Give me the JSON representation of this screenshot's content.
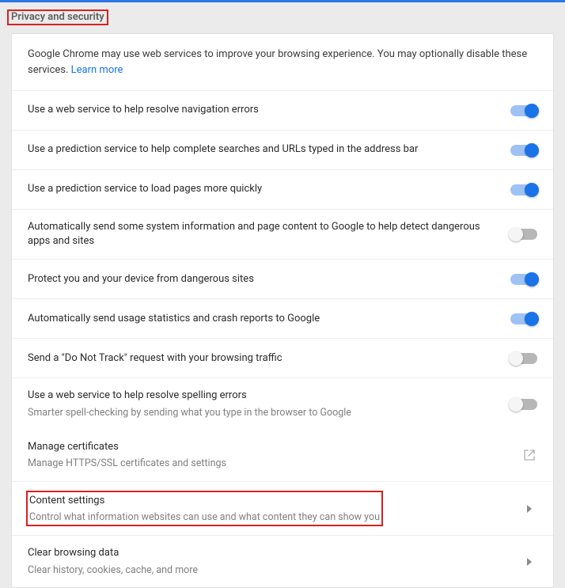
{
  "section_title": "Privacy and security",
  "intro": {
    "text": "Google Chrome may use web services to improve your browsing experience. You may optionally disable these services. ",
    "link": "Learn more"
  },
  "items": [
    {
      "title": "Use a web service to help resolve navigation errors",
      "toggle": true
    },
    {
      "title": "Use a prediction service to help complete searches and URLs typed in the address bar",
      "toggle": true
    },
    {
      "title": "Use a prediction service to load pages more quickly",
      "toggle": true
    },
    {
      "title": "Automatically send some system information and page content to Google to help detect dangerous apps and sites",
      "toggle": false
    },
    {
      "title": "Protect you and your device from dangerous sites",
      "toggle": true
    },
    {
      "title": "Automatically send usage statistics and crash reports to Google",
      "toggle": true
    },
    {
      "title": "Send a \"Do Not Track\" request with your browsing traffic",
      "toggle": false
    },
    {
      "title": "Use a web service to help resolve spelling errors",
      "sub": "Smarter spell-checking by sending what you type in the browser to Google",
      "toggle": false
    }
  ],
  "nav": [
    {
      "title": "Manage certificates",
      "sub": "Manage HTTPS/SSL certificates and settings",
      "icon": "external"
    },
    {
      "title": "Content settings",
      "sub": "Control what information websites can use and what content they can show you",
      "icon": "chevron",
      "highlight": true
    },
    {
      "title": "Clear browsing data",
      "sub": "Clear history, cookies, cache, and more",
      "icon": "chevron"
    }
  ]
}
